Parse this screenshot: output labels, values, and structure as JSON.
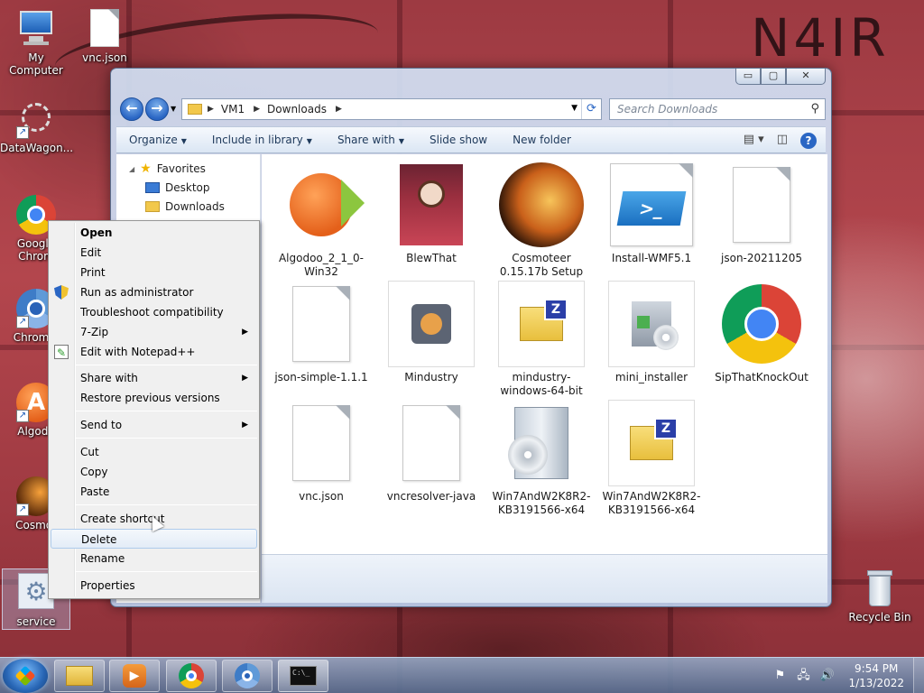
{
  "wallpaper": {
    "text": "N4IR"
  },
  "desktop_icons": [
    {
      "id": "my-computer",
      "label": "My Computer"
    },
    {
      "id": "vnc-json",
      "label": "vnc.json"
    },
    {
      "id": "datawagon",
      "label": "DataWagon..."
    },
    {
      "id": "google-chrome",
      "label": "Google Chrom"
    },
    {
      "id": "chromium",
      "label": "Chromiu"
    },
    {
      "id": "algodoo",
      "label": "Algodo"
    },
    {
      "id": "cosmoteer",
      "label": "Cosmot"
    },
    {
      "id": "service",
      "label": "service"
    },
    {
      "id": "recycle-bin",
      "label": "Recycle Bin"
    }
  ],
  "explorer": {
    "controls": {
      "minimize": "▭",
      "maximize": "▢",
      "close": "✕"
    },
    "back": "←",
    "forward": "→",
    "breadcrumb": [
      "VM1",
      "Downloads"
    ],
    "search_placeholder": "Search Downloads",
    "toolbar": {
      "organize": "Organize",
      "include_in_library": "Include in library",
      "share_with": "Share with",
      "slide_show": "Slide show",
      "new_folder": "New folder"
    },
    "nav": {
      "favorites": "Favorites",
      "desktop": "Desktop",
      "downloads": "Downloads"
    },
    "files": [
      {
        "name": "Algodoo_2_1_0-Win32",
        "kind": "algodoo"
      },
      {
        "name": "BlewThat",
        "kind": "image"
      },
      {
        "name": "Cosmoteer 0.15.17b Setup",
        "kind": "cosmoteer"
      },
      {
        "name": "Install-WMF5.1",
        "kind": "powershell"
      },
      {
        "name": "json-20211205",
        "kind": "blank"
      },
      {
        "name": "json-simple-1.1.1",
        "kind": "blank"
      },
      {
        "name": "Mindustry",
        "kind": "mindustry"
      },
      {
        "name": "mindustry-windows-64-bit",
        "kind": "zip"
      },
      {
        "name": "mini_installer",
        "kind": "installer"
      },
      {
        "name": "SipThatKnockOut",
        "kind": "chrome"
      },
      {
        "name": "vnc.json",
        "kind": "blank"
      },
      {
        "name": "vncresolver-java",
        "kind": "blank"
      },
      {
        "name": "Win7AndW2K8R2-KB3191566-x64",
        "kind": "setup"
      },
      {
        "name": "Win7AndW2K8R2-KB3191566-x64",
        "kind": "zip"
      }
    ]
  },
  "context_menu": {
    "items": [
      {
        "label": "Open"
      },
      {
        "label": "Edit"
      },
      {
        "label": "Print"
      },
      {
        "label": "Run as administrator"
      },
      {
        "label": "Troubleshoot compatibility"
      },
      {
        "label": "7-Zip"
      },
      {
        "label": "Edit with Notepad++"
      },
      {
        "label": "Share with"
      },
      {
        "label": "Restore previous versions"
      },
      {
        "label": "Send to"
      },
      {
        "label": "Cut"
      },
      {
        "label": "Copy"
      },
      {
        "label": "Paste"
      },
      {
        "label": "Create shortcut"
      },
      {
        "label": "Delete"
      },
      {
        "label": "Rename"
      },
      {
        "label": "Properties"
      }
    ]
  },
  "taskbar": {
    "time": "9:54 PM",
    "date": "1/13/2022"
  }
}
